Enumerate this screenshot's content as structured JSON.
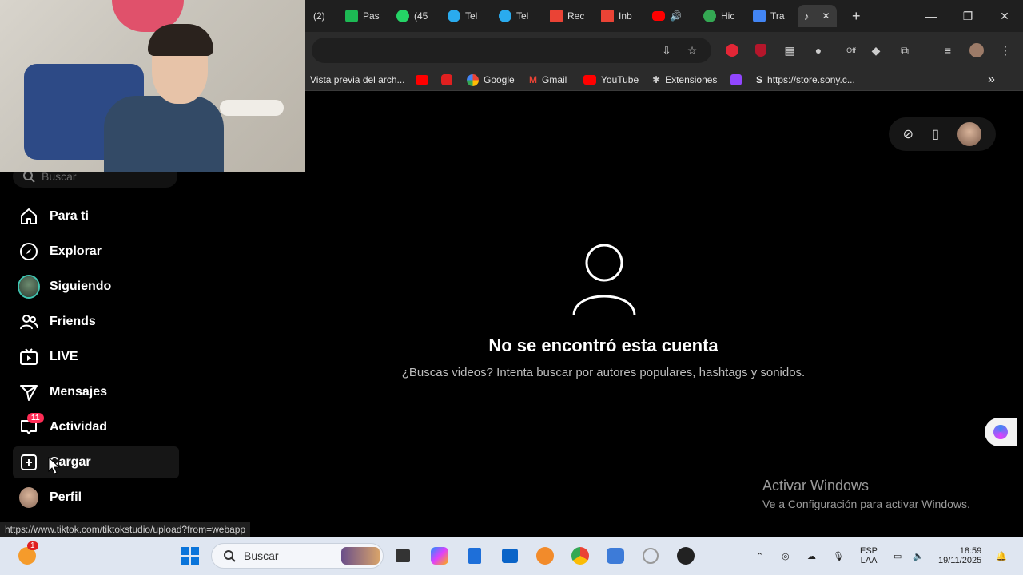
{
  "browser": {
    "tabs": [
      {
        "label": "(2)",
        "color": "#e0e0e0"
      },
      {
        "label": "Pas",
        "color": "#1db954"
      },
      {
        "label": "(45",
        "color": "#25d366"
      },
      {
        "label": "Tel",
        "color": "#2aabee"
      },
      {
        "label": "Tel",
        "color": "#2aabee"
      },
      {
        "label": "Rec",
        "color": "#ea4335"
      },
      {
        "label": "Inb",
        "color": "#ea4335"
      },
      {
        "label": "",
        "color": "#ff0000"
      },
      {
        "label": "Hic",
        "color": "#34a853"
      },
      {
        "label": "Tra",
        "color": "#4285f4"
      }
    ],
    "active_tab_close": "✕",
    "new_tab": "+",
    "window_controls": {
      "minimize": "—",
      "restore": "❐",
      "close": "✕"
    },
    "extensions_off_label": "Off"
  },
  "bookmarks": [
    {
      "label": "Vista previa del arch...",
      "icon": "file-icon",
      "color": "#2b2b2b"
    },
    {
      "label": "",
      "icon": "youtube-icon",
      "color": "#ff0000"
    },
    {
      "label": "",
      "icon": "app-icon",
      "color": "#e02020"
    },
    {
      "label": "Google",
      "icon": "google-icon",
      "color": "#4285f4"
    },
    {
      "label": "Gmail",
      "icon": "gmail-icon",
      "color": "#ea4335"
    },
    {
      "label": "YouTube",
      "icon": "youtube-icon",
      "color": "#ff0000"
    },
    {
      "label": "Extensiones",
      "icon": "puzzle-icon",
      "color": "#bbbbbb"
    },
    {
      "label": "",
      "icon": "twitch-icon",
      "color": "#9146ff"
    },
    {
      "label": "https://store.sony.c...",
      "icon": "sony-icon",
      "color": "#ffffff"
    }
  ],
  "bookmarks_overflow": "»",
  "sidebar": {
    "search_placeholder": "Buscar",
    "items": [
      {
        "label": "Para ti",
        "icon": "home-icon"
      },
      {
        "label": "Explorar",
        "icon": "compass-icon"
      },
      {
        "label": "Siguiendo",
        "icon": "following-avatar"
      },
      {
        "label": "Friends",
        "icon": "friends-icon"
      },
      {
        "label": "LIVE",
        "icon": "live-tv-icon"
      },
      {
        "label": "Mensajes",
        "icon": "send-icon"
      },
      {
        "label": "Actividad",
        "icon": "inbox-icon",
        "badge": "11"
      },
      {
        "label": "Cargar",
        "icon": "upload-plus-icon"
      },
      {
        "label": "Perfil",
        "icon": "profile-avatar"
      }
    ]
  },
  "main": {
    "empty_title": "No se encontró esta cuenta",
    "empty_subtitle": "¿Buscas videos? Intenta buscar por autores populares, hashtags y sonidos."
  },
  "watermark": {
    "title": "Activar Windows",
    "subtitle": "Ve a Configuración para activar Windows."
  },
  "status_url": "https://www.tiktok.com/tiktokstudio/upload?from=webapp",
  "taskbar": {
    "search_label": "Buscar",
    "notification_count": "1",
    "language": "ESP",
    "language_sub": "LAA",
    "time": "18:59",
    "date": "19/11/2025"
  },
  "colors": {
    "accent": "#fe2c55",
    "background": "#000000",
    "taskbar": "#dfe6f1"
  }
}
